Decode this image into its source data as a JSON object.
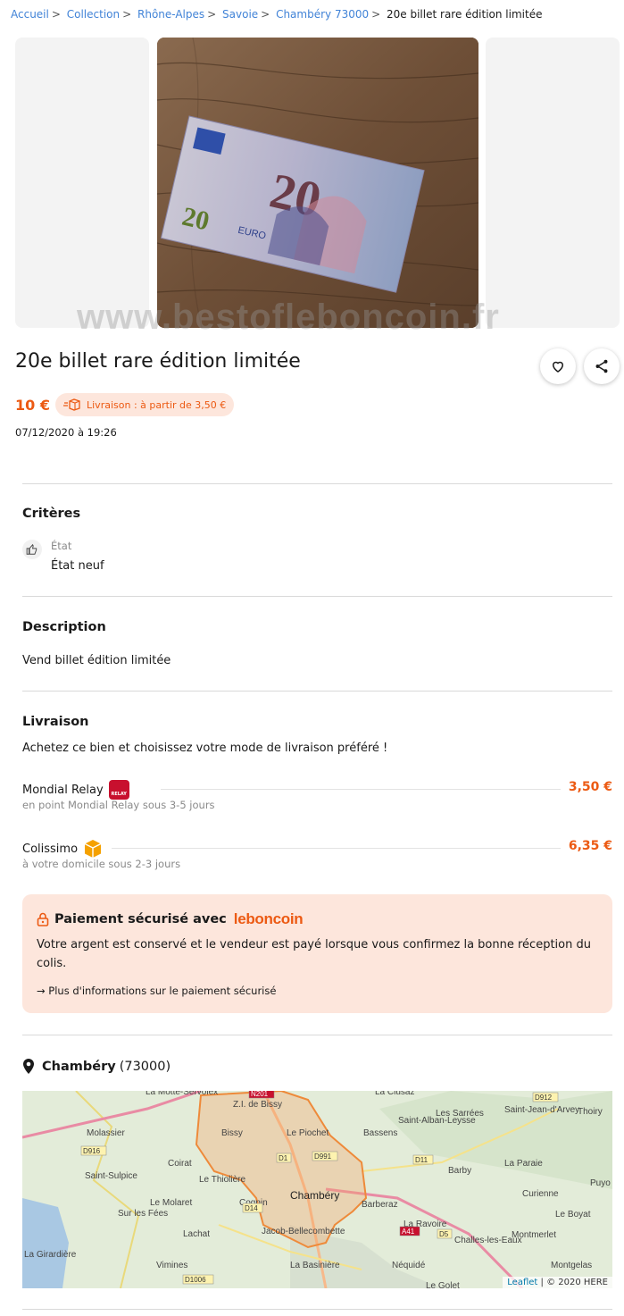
{
  "breadcrumb": {
    "items": [
      "Accueil",
      "Collection",
      "Rhône-Alpes",
      "Savoie",
      "Chambéry 73000"
    ],
    "current": "20e billet rare édition limitée",
    "separator": ">"
  },
  "gallery": {
    "watermark": "www.bestofleboncoin.fr",
    "banknote": {
      "value": "20",
      "currency_text": "EURO ΕΥΡΩ ЕВРО"
    }
  },
  "listing": {
    "title": "20e billet rare édition limitée",
    "price": "10 €",
    "shipping_badge": "Livraison : à partir de 3,50 €",
    "date": "07/12/2020 à 19:26"
  },
  "actions": {
    "favorite_icon": "heart-icon",
    "share_icon": "share-icon"
  },
  "criteria": {
    "heading": "Critères",
    "items": [
      {
        "label": "État",
        "value": "État neuf",
        "icon": "thumbs-up-icon"
      }
    ]
  },
  "description": {
    "heading": "Description",
    "text": "Vend billet édition limitée"
  },
  "delivery": {
    "heading": "Livraison",
    "intro": "Achetez ce bien et choisissez votre mode de livraison préféré !",
    "options": [
      {
        "name": "Mondial Relay",
        "detail": "en point Mondial Relay sous 3-5 jours",
        "price": "3,50 €",
        "icon": "mondial-relay-logo",
        "badge_text": "RELAY"
      },
      {
        "name": "Colissimo",
        "detail": "à votre domicile sous 2-3 jours",
        "price": "6,35 €",
        "icon": "colissimo-box-icon"
      }
    ]
  },
  "payment": {
    "title": "Paiement sécurisé avec",
    "brand": "leboncoin",
    "text": "Votre argent est conservé et le vendeur est payé lorsque vous confirmez la bonne réception du colis.",
    "link": "→ Plus d'informations sur le paiement sécurisé"
  },
  "location": {
    "city": "Chambéry",
    "postcode": "(73000)"
  },
  "map": {
    "credit_leaflet": "Leaflet",
    "credit_here": "| © 2020 HERE",
    "labels": [
      "La Motte-Servolex",
      "La Clusaz",
      "Les Sarrées",
      "Saint-Jean-d'Arvey",
      "Thoiry",
      "Z.I. de Bissy",
      "Molassier",
      "Bissy",
      "Le Piochet",
      "Bassens",
      "Saint-Alban-Leysse",
      "Coirat",
      "Barby",
      "La Paraie",
      "Saint-Sulpice",
      "Le Thiolière",
      "Chambéry",
      "Curienne",
      "Puyo",
      "Le Molaret",
      "Cognin",
      "Barberaz",
      "Le Boyat",
      "Sur les Fées",
      "Lachat",
      "La Ravoire",
      "Jacob-Bellecombette",
      "Montmerlet",
      "Challes-les-Eaux",
      "Vimines",
      "La Basinière",
      "Néquidé",
      "Montgelas",
      "La Girardière",
      "Le Golet"
    ],
    "roads": [
      "N201",
      "D916",
      "D912",
      "D1",
      "D991",
      "D11",
      "D14",
      "A41",
      "D5",
      "D1006"
    ]
  }
}
